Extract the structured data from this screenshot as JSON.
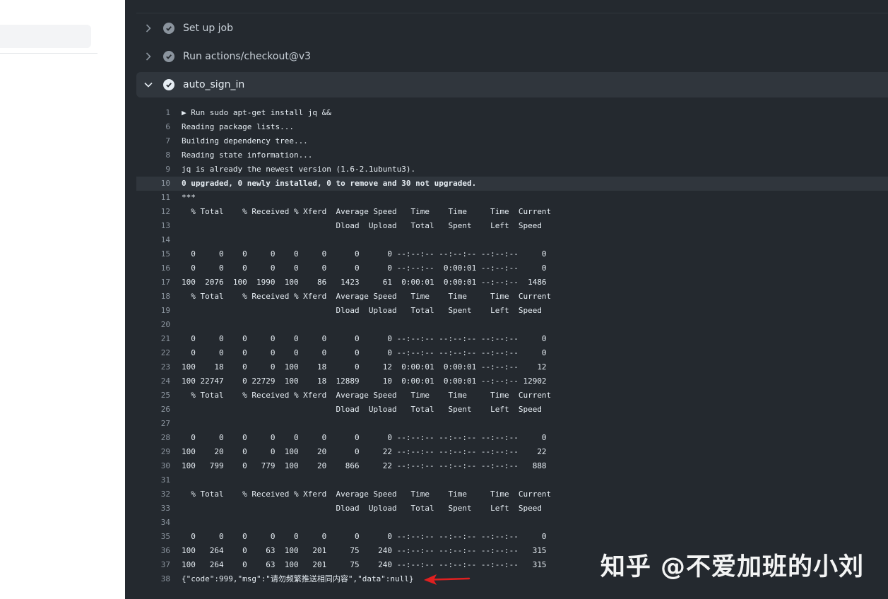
{
  "steps": [
    {
      "label": "Set up job",
      "state": "collapsed"
    },
    {
      "label": "Run actions/checkout@v3",
      "state": "collapsed"
    },
    {
      "label": "auto_sign_in",
      "state": "expanded"
    }
  ],
  "log": [
    {
      "n": "1",
      "t": "▶ Run sudo apt-get install jq &&"
    },
    {
      "n": "6",
      "t": "Reading package lists..."
    },
    {
      "n": "7",
      "t": "Building dependency tree..."
    },
    {
      "n": "8",
      "t": "Reading state information..."
    },
    {
      "n": "9",
      "t": "jq is already the newest version (1.6-2.1ubuntu3)."
    },
    {
      "n": "10",
      "t": "0 upgraded, 0 newly installed, 0 to remove and 30 not upgraded.",
      "hl": true
    },
    {
      "n": "11",
      "t": "***"
    },
    {
      "n": "12",
      "t": "  % Total    % Received % Xferd  Average Speed   Time    Time     Time  Current"
    },
    {
      "n": "13",
      "t": "                                 Dload  Upload   Total   Spent    Left  Speed"
    },
    {
      "n": "14",
      "t": ""
    },
    {
      "n": "15",
      "t": "  0     0    0     0    0     0      0      0 --:--:-- --:--:-- --:--:--     0"
    },
    {
      "n": "16",
      "t": "  0     0    0     0    0     0      0      0 --:--:--  0:00:01 --:--:--     0"
    },
    {
      "n": "17",
      "t": "100  2076  100  1990  100    86   1423     61  0:00:01  0:00:01 --:--:--  1486"
    },
    {
      "n": "18",
      "t": "  % Total    % Received % Xferd  Average Speed   Time    Time     Time  Current"
    },
    {
      "n": "19",
      "t": "                                 Dload  Upload   Total   Spent    Left  Speed"
    },
    {
      "n": "20",
      "t": ""
    },
    {
      "n": "21",
      "t": "  0     0    0     0    0     0      0      0 --:--:-- --:--:-- --:--:--     0"
    },
    {
      "n": "22",
      "t": "  0     0    0     0    0     0      0      0 --:--:-- --:--:-- --:--:--     0"
    },
    {
      "n": "23",
      "t": "100    18    0     0  100    18      0     12  0:00:01  0:00:01 --:--:--    12"
    },
    {
      "n": "24",
      "t": "100 22747    0 22729  100    18  12889     10  0:00:01  0:00:01 --:--:-- 12902"
    },
    {
      "n": "25",
      "t": "  % Total    % Received % Xferd  Average Speed   Time    Time     Time  Current"
    },
    {
      "n": "26",
      "t": "                                 Dload  Upload   Total   Spent    Left  Speed"
    },
    {
      "n": "27",
      "t": ""
    },
    {
      "n": "28",
      "t": "  0     0    0     0    0     0      0      0 --:--:-- --:--:-- --:--:--     0"
    },
    {
      "n": "29",
      "t": "100    20    0     0  100    20      0     22 --:--:-- --:--:-- --:--:--    22"
    },
    {
      "n": "30",
      "t": "100   799    0   779  100    20    866     22 --:--:-- --:--:-- --:--:--   888"
    },
    {
      "n": "31",
      "t": ""
    },
    {
      "n": "32",
      "t": "  % Total    % Received % Xferd  Average Speed   Time    Time     Time  Current"
    },
    {
      "n": "33",
      "t": "                                 Dload  Upload   Total   Spent    Left  Speed"
    },
    {
      "n": "34",
      "t": ""
    },
    {
      "n": "35",
      "t": "  0     0    0     0    0     0      0      0 --:--:-- --:--:-- --:--:--     0"
    },
    {
      "n": "36",
      "t": "100   264    0    63  100   201     75    240 --:--:-- --:--:-- --:--:--   315"
    },
    {
      "n": "37",
      "t": "100   264    0    63  100   201     75    240 --:--:-- --:--:-- --:--:--   315"
    },
    {
      "n": "38",
      "t": "{\"code\":999,\"msg\":\"请勿频繁推送相同内容\",\"data\":null}"
    }
  ],
  "watermark": "知乎 @不爱加班的小刘",
  "colors": {
    "panel_bg": "#24292f",
    "arrow": "#e02020"
  }
}
